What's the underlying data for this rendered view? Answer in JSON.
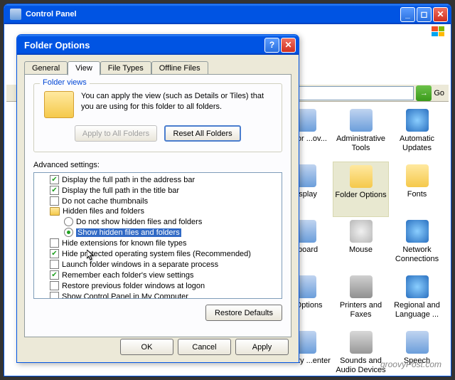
{
  "mainWindow": {
    "title": "Control Panel",
    "goLabel": "Go"
  },
  "cpIcons": {
    "r1c1": "...ld or\n...ov...",
    "r1c2": "Administrative Tools",
    "r1c3": "Automatic Updates",
    "r2c1": "...splay",
    "r2c2": "Folder Options",
    "r2c3": "Fonts",
    "r3c1": "...board",
    "r3c2": "Mouse",
    "r3c3": "Network Connections",
    "r4c1": "... Options",
    "r4c2": "Printers and Faxes",
    "r4c3": "Regional and Language ...",
    "r5c1": "...curity\n...enter",
    "r5c2": "Sounds and Audio Devices",
    "r5c3": "Speech"
  },
  "dialog": {
    "title": "Folder Options",
    "tabs": {
      "general": "General",
      "view": "View",
      "fileTypes": "File Types",
      "offlineFiles": "Offline Files"
    },
    "folderViews": {
      "legend": "Folder views",
      "text": "You can apply the view (such as Details or Tiles) that you are using for this folder to all folders.",
      "applyBtn": "Apply to All Folders",
      "resetBtn": "Reset All Folders"
    },
    "advancedLabel": "Advanced settings:",
    "tree": {
      "i1": "Display the full path in the address bar",
      "i2": "Display the full path in the title bar",
      "i3": "Do not cache thumbnails",
      "i4": "Hidden files and folders",
      "i5": "Do not show hidden files and folders",
      "i6": "Show hidden files and folders",
      "i7": "Hide extensions for known file types",
      "i8": "Hide protected operating system files (Recommended)",
      "i9": "Launch folder windows in a separate process",
      "i10": "Remember each folder's view settings",
      "i11": "Restore previous folder windows at logon",
      "i12": "Show Control Panel in My Computer"
    },
    "restoreDefaults": "Restore Defaults",
    "ok": "OK",
    "cancel": "Cancel",
    "apply": "Apply"
  },
  "footer": "groovyPost.com"
}
